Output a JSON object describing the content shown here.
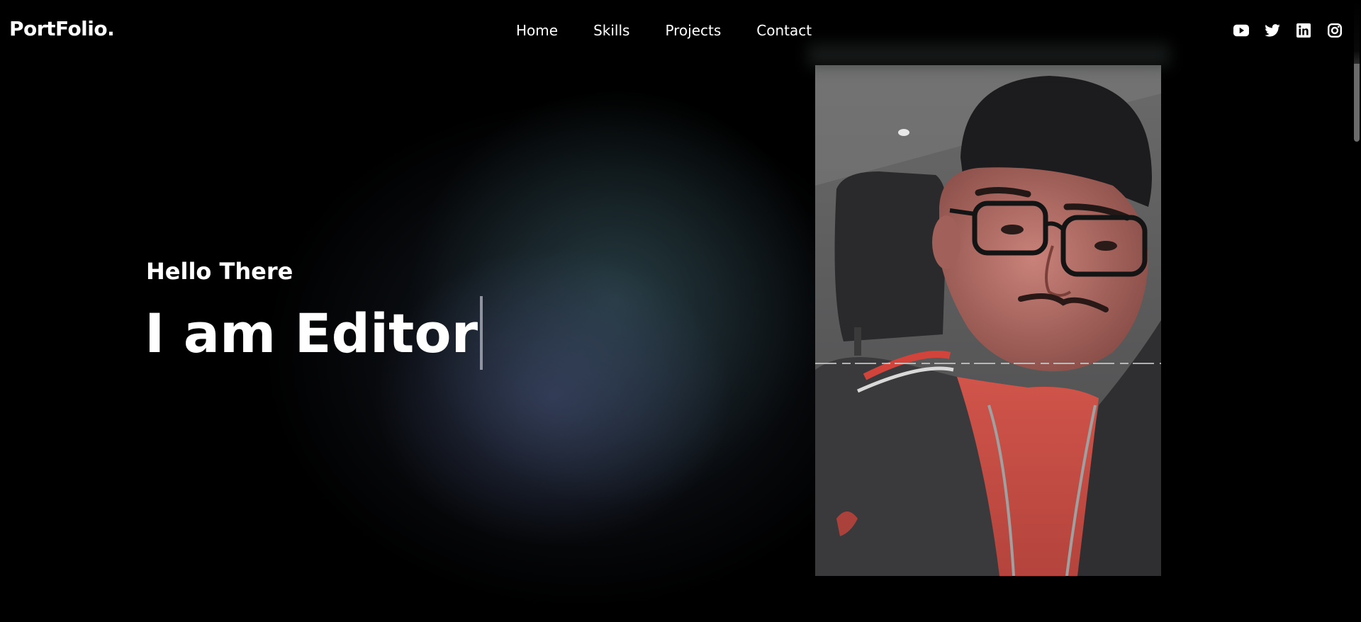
{
  "header": {
    "logo": "PortFolio.",
    "nav": [
      {
        "label": "Home"
      },
      {
        "label": "Skills"
      },
      {
        "label": "Projects"
      },
      {
        "label": "Contact"
      }
    ],
    "socials": [
      {
        "icon": "youtube-icon"
      },
      {
        "icon": "twitter-icon"
      },
      {
        "icon": "linkedin-icon"
      },
      {
        "icon": "instagram-icon"
      }
    ]
  },
  "hero": {
    "greeting": "Hello There",
    "title": "I am Editor"
  },
  "colors": {
    "background": "#000000",
    "text": "#ffffff",
    "caret": "#8f94a0"
  }
}
